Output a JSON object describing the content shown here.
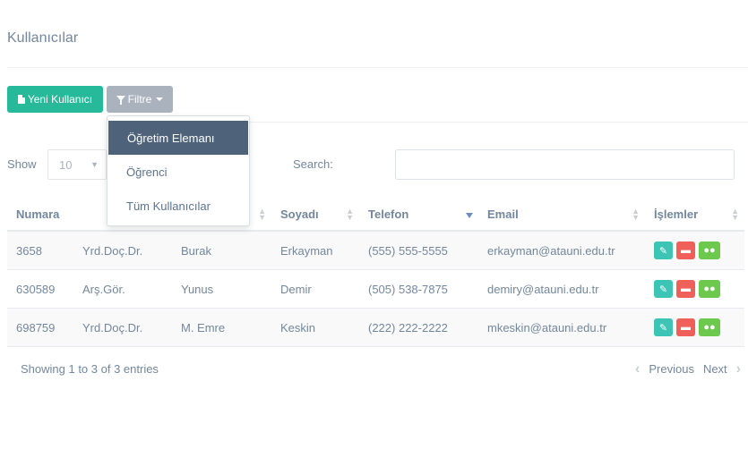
{
  "page": {
    "title": "Kullanıcılar"
  },
  "toolbar": {
    "new_user_label": "Yeni Kullanıcı",
    "new_user_icon": "file-icon",
    "filter_label": "Filtre",
    "filter_icon": "funnel-icon"
  },
  "filter_menu": {
    "items": [
      {
        "label": "Öğretim Elemanı",
        "active": true
      },
      {
        "label": "Öğrenci",
        "active": false
      },
      {
        "label": "Tüm Kullanıcılar",
        "active": false
      }
    ]
  },
  "table_controls": {
    "length_label": "Show",
    "length_value": "10",
    "search_label": "Search:",
    "search_value": ""
  },
  "table": {
    "columns": [
      "Numara",
      "",
      "",
      "Soyadı",
      "Telefon",
      "Email",
      "İşlemler"
    ],
    "rows": [
      [
        "3658",
        "Yrd.Doç.Dr.",
        "Burak",
        "Erkayman",
        "(555) 555-5555",
        "erkayman@atauni.edu.tr"
      ],
      [
        "630589",
        "Arş.Gör.",
        "Yunus",
        "Demir",
        "(505) 538-7875",
        "demiry@atauni.edu.tr"
      ],
      [
        "698759",
        "Yrd.Doç.Dr.",
        "M. Emre",
        "Keskin",
        "(222) 222-2222",
        "mkeskin@atauni.edu.tr"
      ]
    ]
  },
  "footer": {
    "info": "Showing 1 to 3 of 3 entries",
    "previous": "Previous",
    "next": "Next"
  },
  "colors": {
    "primary_button": "#26b99a",
    "filter_button": "#aab2bd",
    "active_menu": "#4e637a",
    "edit": "#3cc5b4",
    "delete": "#f0605a",
    "group": "#6cc94e"
  }
}
